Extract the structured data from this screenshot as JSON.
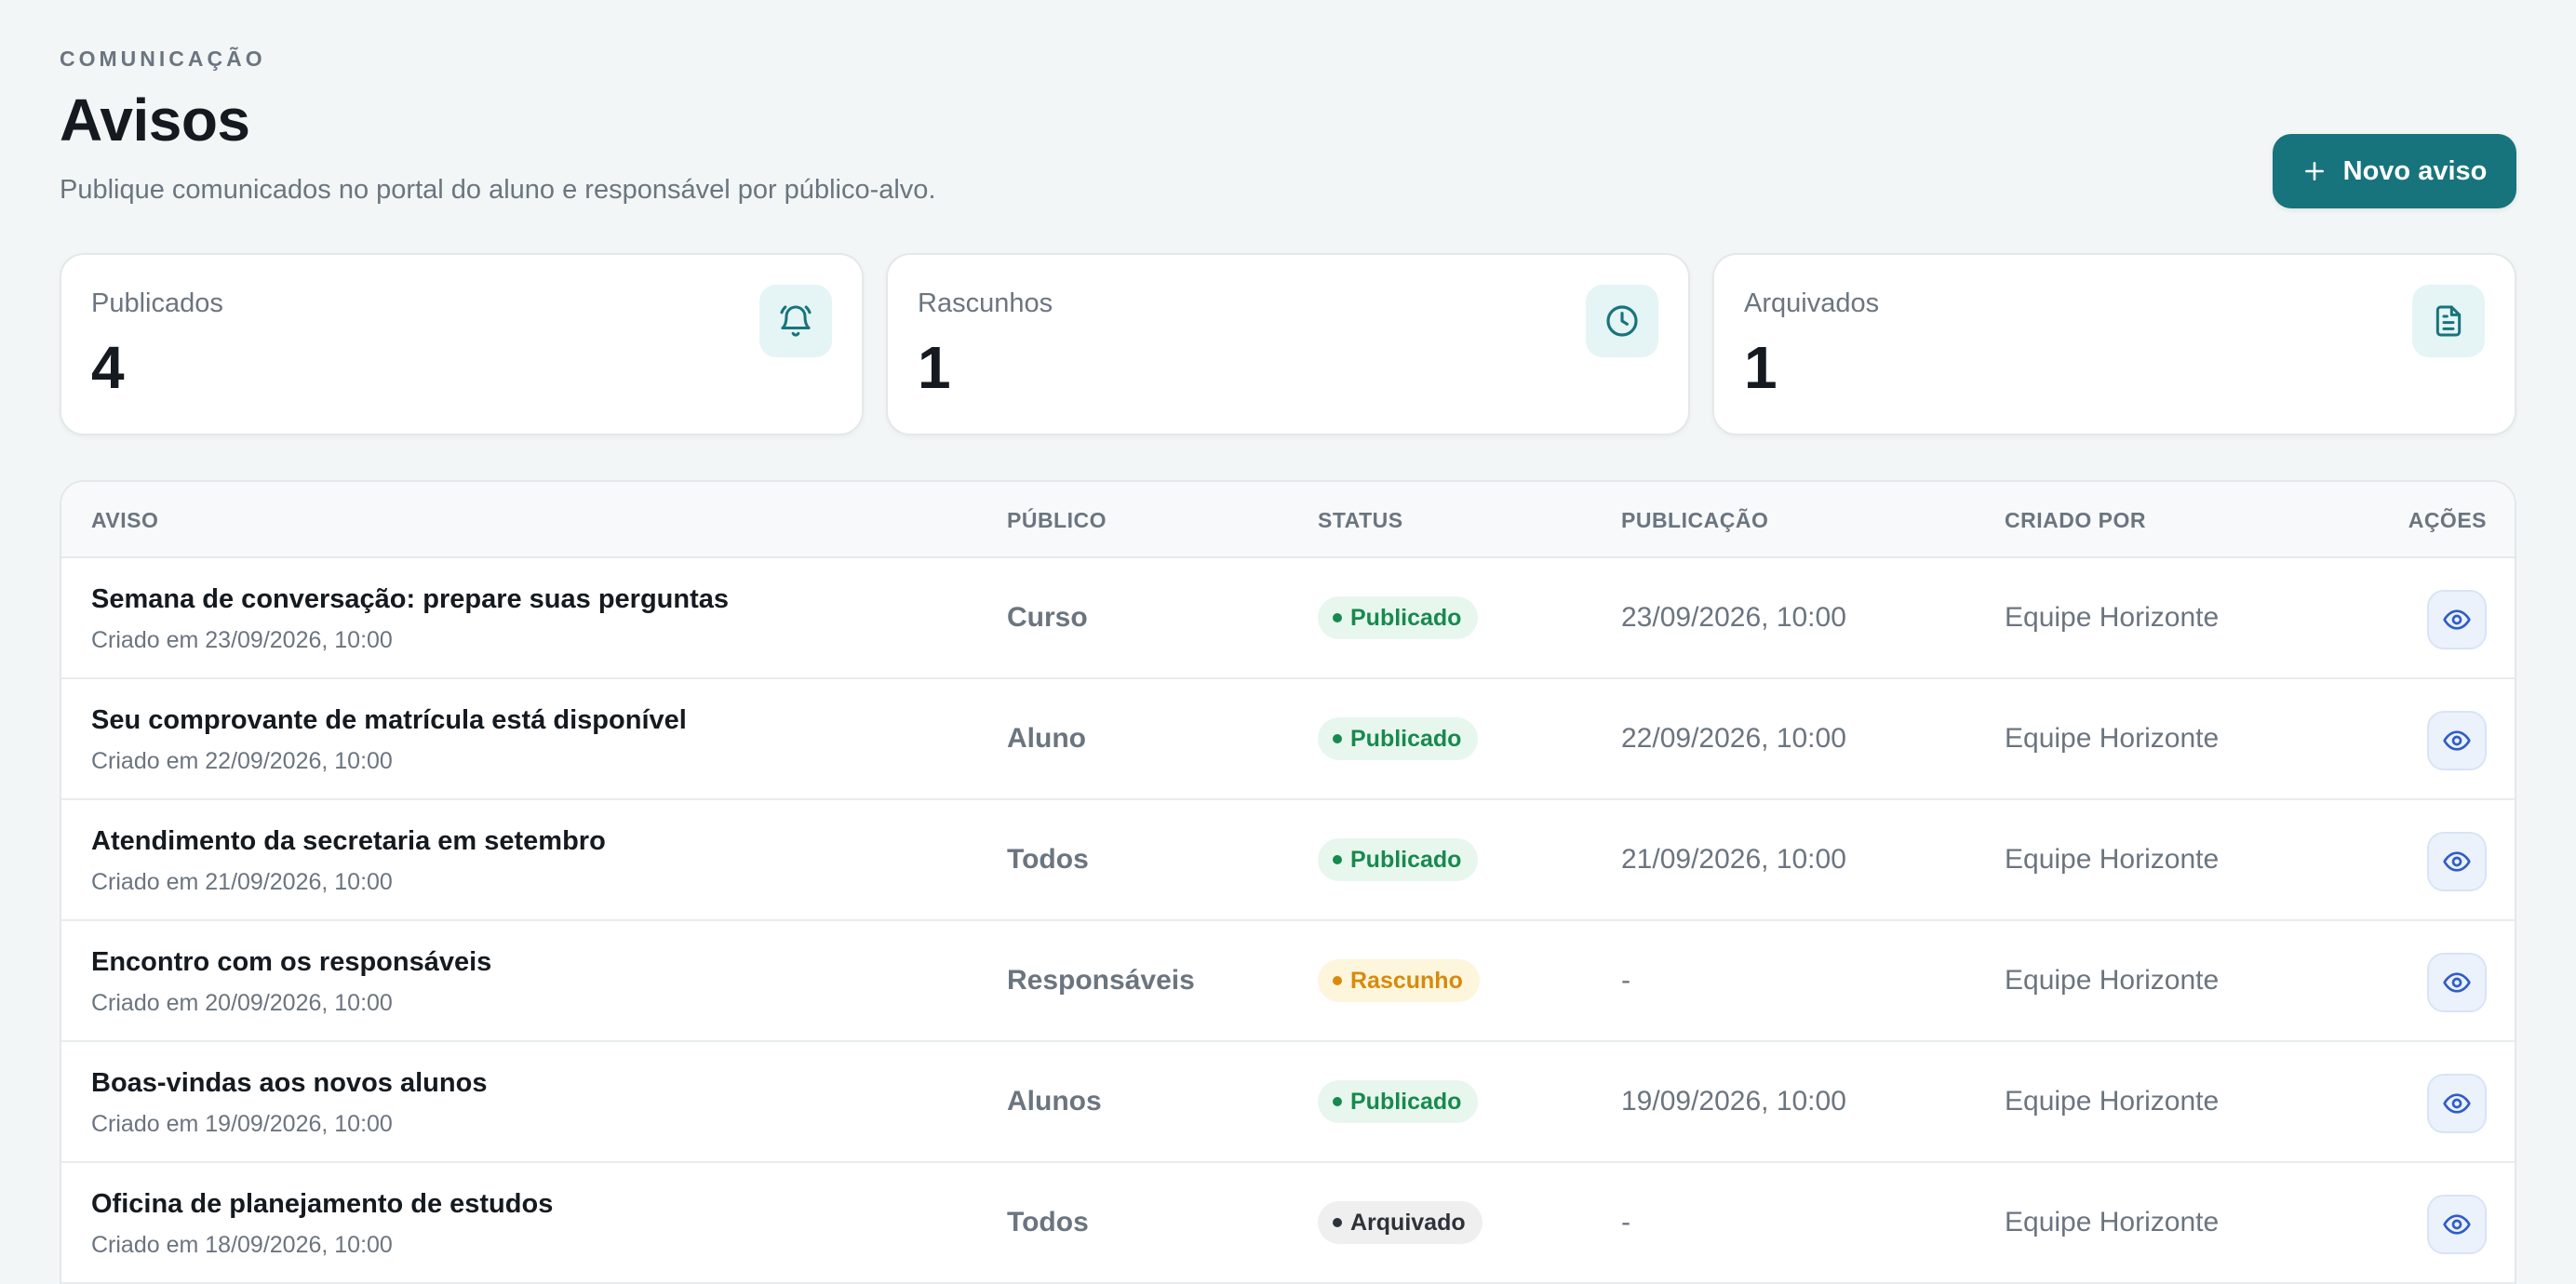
{
  "header": {
    "eyebrow": "COMUNICAÇÃO",
    "title": "Avisos",
    "subtitle": "Publique comunicados no portal do aluno e responsável por público-alvo.",
    "new_button_label": "Novo aviso"
  },
  "stats": [
    {
      "label": "Publicados",
      "value": "4",
      "icon": "bell-icon"
    },
    {
      "label": "Rascunhos",
      "value": "1",
      "icon": "clock-icon"
    },
    {
      "label": "Arquivados",
      "value": "1",
      "icon": "document-icon"
    }
  ],
  "table": {
    "columns": [
      "AVISO",
      "PÚBLICO",
      "STATUS",
      "PUBLICAÇÃO",
      "CRIADO POR",
      "AÇÕES"
    ],
    "rows": [
      {
        "title": "Semana de conversação: prepare suas perguntas",
        "created": "Criado em 23/09/2026, 10:00",
        "audience": "Curso",
        "status": "Publicado",
        "published": "23/09/2026, 10:00",
        "author": "Equipe Horizonte"
      },
      {
        "title": "Seu comprovante de matrícula está disponível",
        "created": "Criado em 22/09/2026, 10:00",
        "audience": "Aluno",
        "status": "Publicado",
        "published": "22/09/2026, 10:00",
        "author": "Equipe Horizonte"
      },
      {
        "title": "Atendimento da secretaria em setembro",
        "created": "Criado em 21/09/2026, 10:00",
        "audience": "Todos",
        "status": "Publicado",
        "published": "21/09/2026, 10:00",
        "author": "Equipe Horizonte"
      },
      {
        "title": "Encontro com os responsáveis",
        "created": "Criado em 20/09/2026, 10:00",
        "audience": "Responsáveis",
        "status": "Rascunho",
        "published": "-",
        "author": "Equipe Horizonte"
      },
      {
        "title": "Boas-vindas aos novos alunos",
        "created": "Criado em 19/09/2026, 10:00",
        "audience": "Alunos",
        "status": "Publicado",
        "published": "19/09/2026, 10:00",
        "author": "Equipe Horizonte"
      },
      {
        "title": "Oficina de planejamento de estudos",
        "created": "Criado em 18/09/2026, 10:00",
        "audience": "Todos",
        "status": "Arquivado",
        "published": "-",
        "author": "Equipe Horizonte"
      }
    ]
  },
  "colors": {
    "primary": "#17747d",
    "published_bg": "#e8f7ee",
    "published_fg": "#178a4e",
    "draft_bg": "#fdf6dc",
    "draft_fg": "#d88a0c",
    "archived_bg": "#efefef",
    "archived_fg": "#2d333a",
    "view_icon": "#2f5cc9"
  }
}
